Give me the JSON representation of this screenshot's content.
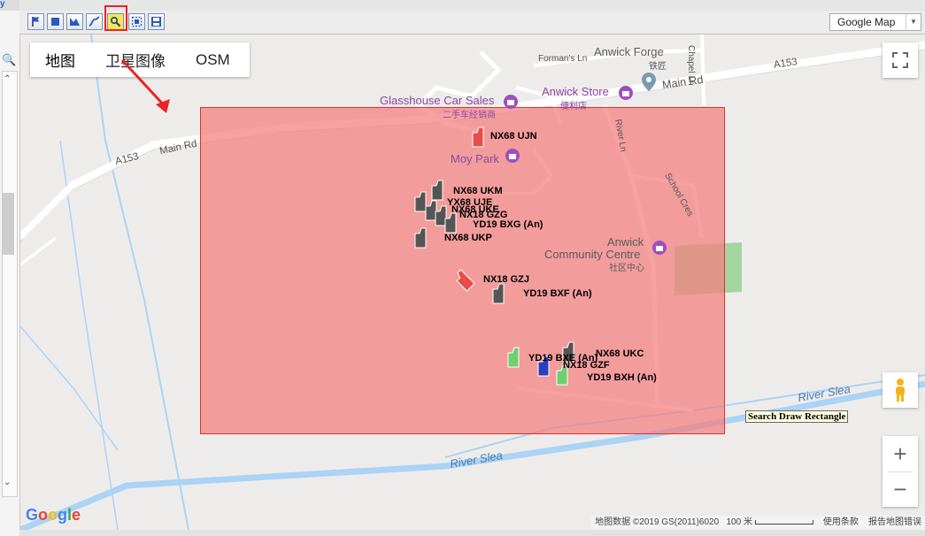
{
  "window": {
    "left_glyph": "y"
  },
  "toolbar": {
    "buttons": [
      {
        "icon": "flag-icon"
      },
      {
        "icon": "stop-square-icon"
      },
      {
        "icon": "polygon-icon"
      },
      {
        "icon": "polyline-icon"
      },
      {
        "icon": "search-icon"
      },
      {
        "icon": "zoom-extent-icon"
      },
      {
        "icon": "save-icon"
      }
    ],
    "map_type_select": "Google Map"
  },
  "map": {
    "tabs": [
      "地图",
      "卫星图像",
      "OSM"
    ],
    "places": {
      "formans_ln": "Forman's Ln",
      "anwick_forge": "Anwick Forge",
      "tiesi": "铁匠",
      "chapel_ln": "Chapel Ln",
      "a153_top": "A153",
      "main_rd_top": "Main Rd",
      "glasshouse": "Glasshouse Car Sales",
      "glasshouse_cn": "二手车经销商",
      "anwick_store": "Anwick Store",
      "anwick_store_cn": "便利店",
      "main_rd_mid": "Main Rd",
      "river_ln": "River Ln",
      "a153_left": "A153",
      "main_rd_left": "Main Rd",
      "moy_park": "Moy Park",
      "school_cres": "School Cres",
      "anwick": "Anwick",
      "community_centre": "Community Centre",
      "community_centre_cn": "社区中心",
      "river_slea_right": "River Slea",
      "river_slea_left": "River Slea"
    },
    "vehicles": [
      {
        "label": "NX68 UJN",
        "color": "#e84c4c"
      },
      {
        "label": "NX68 UKM",
        "color": "#555555"
      },
      {
        "label": "YX68 UJE",
        "color": "#555555"
      },
      {
        "label": "NX68 UKE",
        "color": "#555555"
      },
      {
        "label": "NX18 GZG",
        "color": "#555555"
      },
      {
        "label": "YD19 BXG (An)",
        "color": "#555555"
      },
      {
        "label": "NX68 UKP",
        "color": "#555555"
      },
      {
        "label": "NX18 GZJ",
        "color": "#e84c4c"
      },
      {
        "label": "YD19 BXF (An)",
        "color": "#555555"
      },
      {
        "label": "YD19 BXH (An)",
        "color": "#6fcf6f"
      },
      {
        "label": "NX68 UKC",
        "color": "#555555"
      },
      {
        "label": "NX18 GZF",
        "color": "#2a3fbf"
      },
      {
        "label": "YD19 BXE (An)",
        "color": "#6fcf6f"
      }
    ],
    "search_tooltip": "Search Draw Rectangle",
    "google_logo": "Google",
    "attribution": {
      "data": "地图数据 ©2019 GS(2011)6020",
      "scale": "100 米",
      "terms": "使用条款",
      "report": "报告地图错误"
    },
    "colors": {
      "search_rect": "#f47d7d",
      "road": "#ffffff",
      "river": "#aad3f5"
    }
  }
}
